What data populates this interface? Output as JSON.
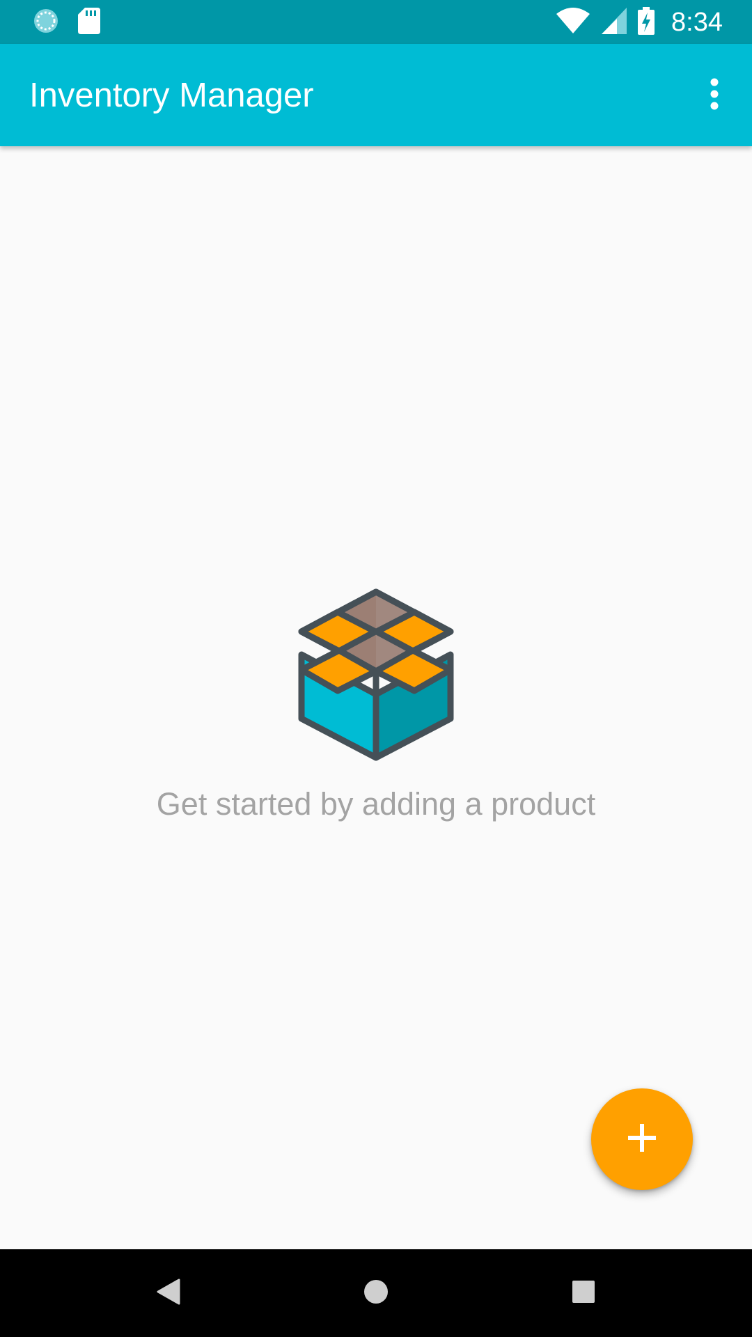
{
  "status_bar": {
    "time": "8:34",
    "icons": [
      "sync-icon",
      "sd-card-icon",
      "wifi-icon",
      "cell-signal-icon",
      "battery-charging-icon"
    ],
    "background": "#0097a7"
  },
  "app_bar": {
    "title": "Inventory Manager",
    "background": "#00bcd4",
    "menu_icon": "more-vert-icon"
  },
  "empty_state": {
    "illustration": "open-box-icon",
    "message": "Get started by adding a product"
  },
  "fab": {
    "icon": "plus-icon",
    "color": "#ffa000"
  },
  "nav_bar": {
    "buttons": [
      "back-icon",
      "home-icon",
      "recents-icon"
    ]
  }
}
